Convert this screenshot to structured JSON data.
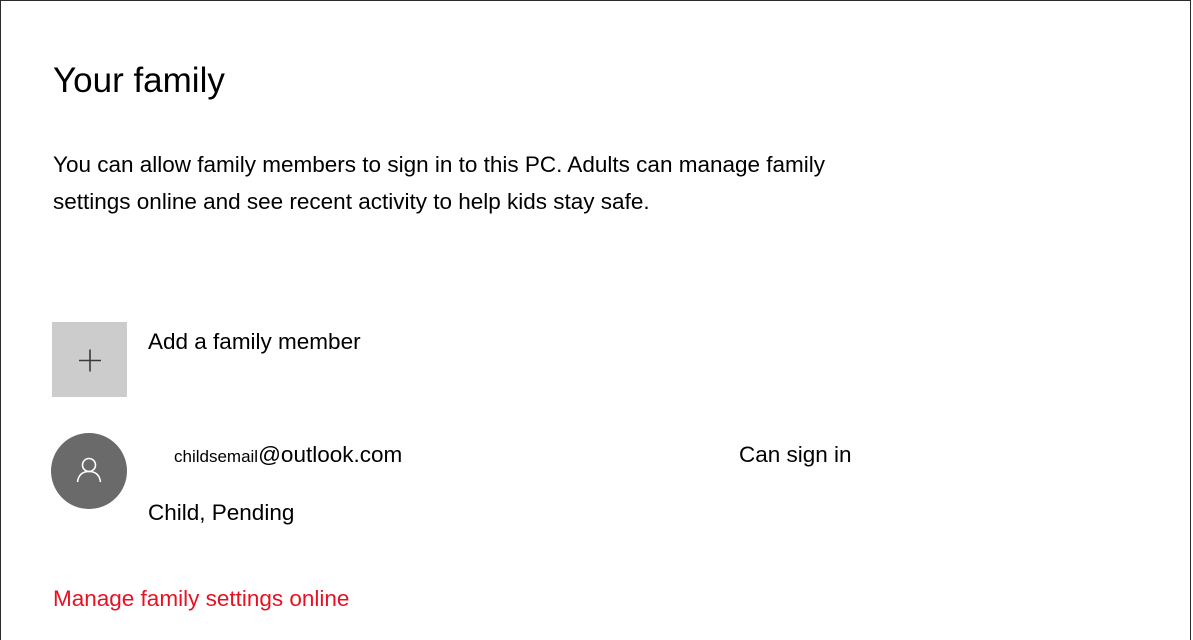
{
  "section": {
    "title": "Your family",
    "description": "You can allow family members to sign in to this PC. Adults can manage family settings online and see recent activity to help kids stay safe."
  },
  "add_member": {
    "icon": "plus-icon",
    "label": "Add a family member"
  },
  "members": [
    {
      "avatar_icon": "person-icon",
      "email_user": "childsemail",
      "email_domain": "@outlook.com",
      "status": "Can sign in",
      "role": "Child, Pending"
    }
  ],
  "manage_link": {
    "label": "Manage family settings online",
    "color": "#e81123"
  },
  "colors": {
    "add_tile_bg": "#cccccc",
    "avatar_bg": "#6a6a6a",
    "accent": "#e81123"
  }
}
